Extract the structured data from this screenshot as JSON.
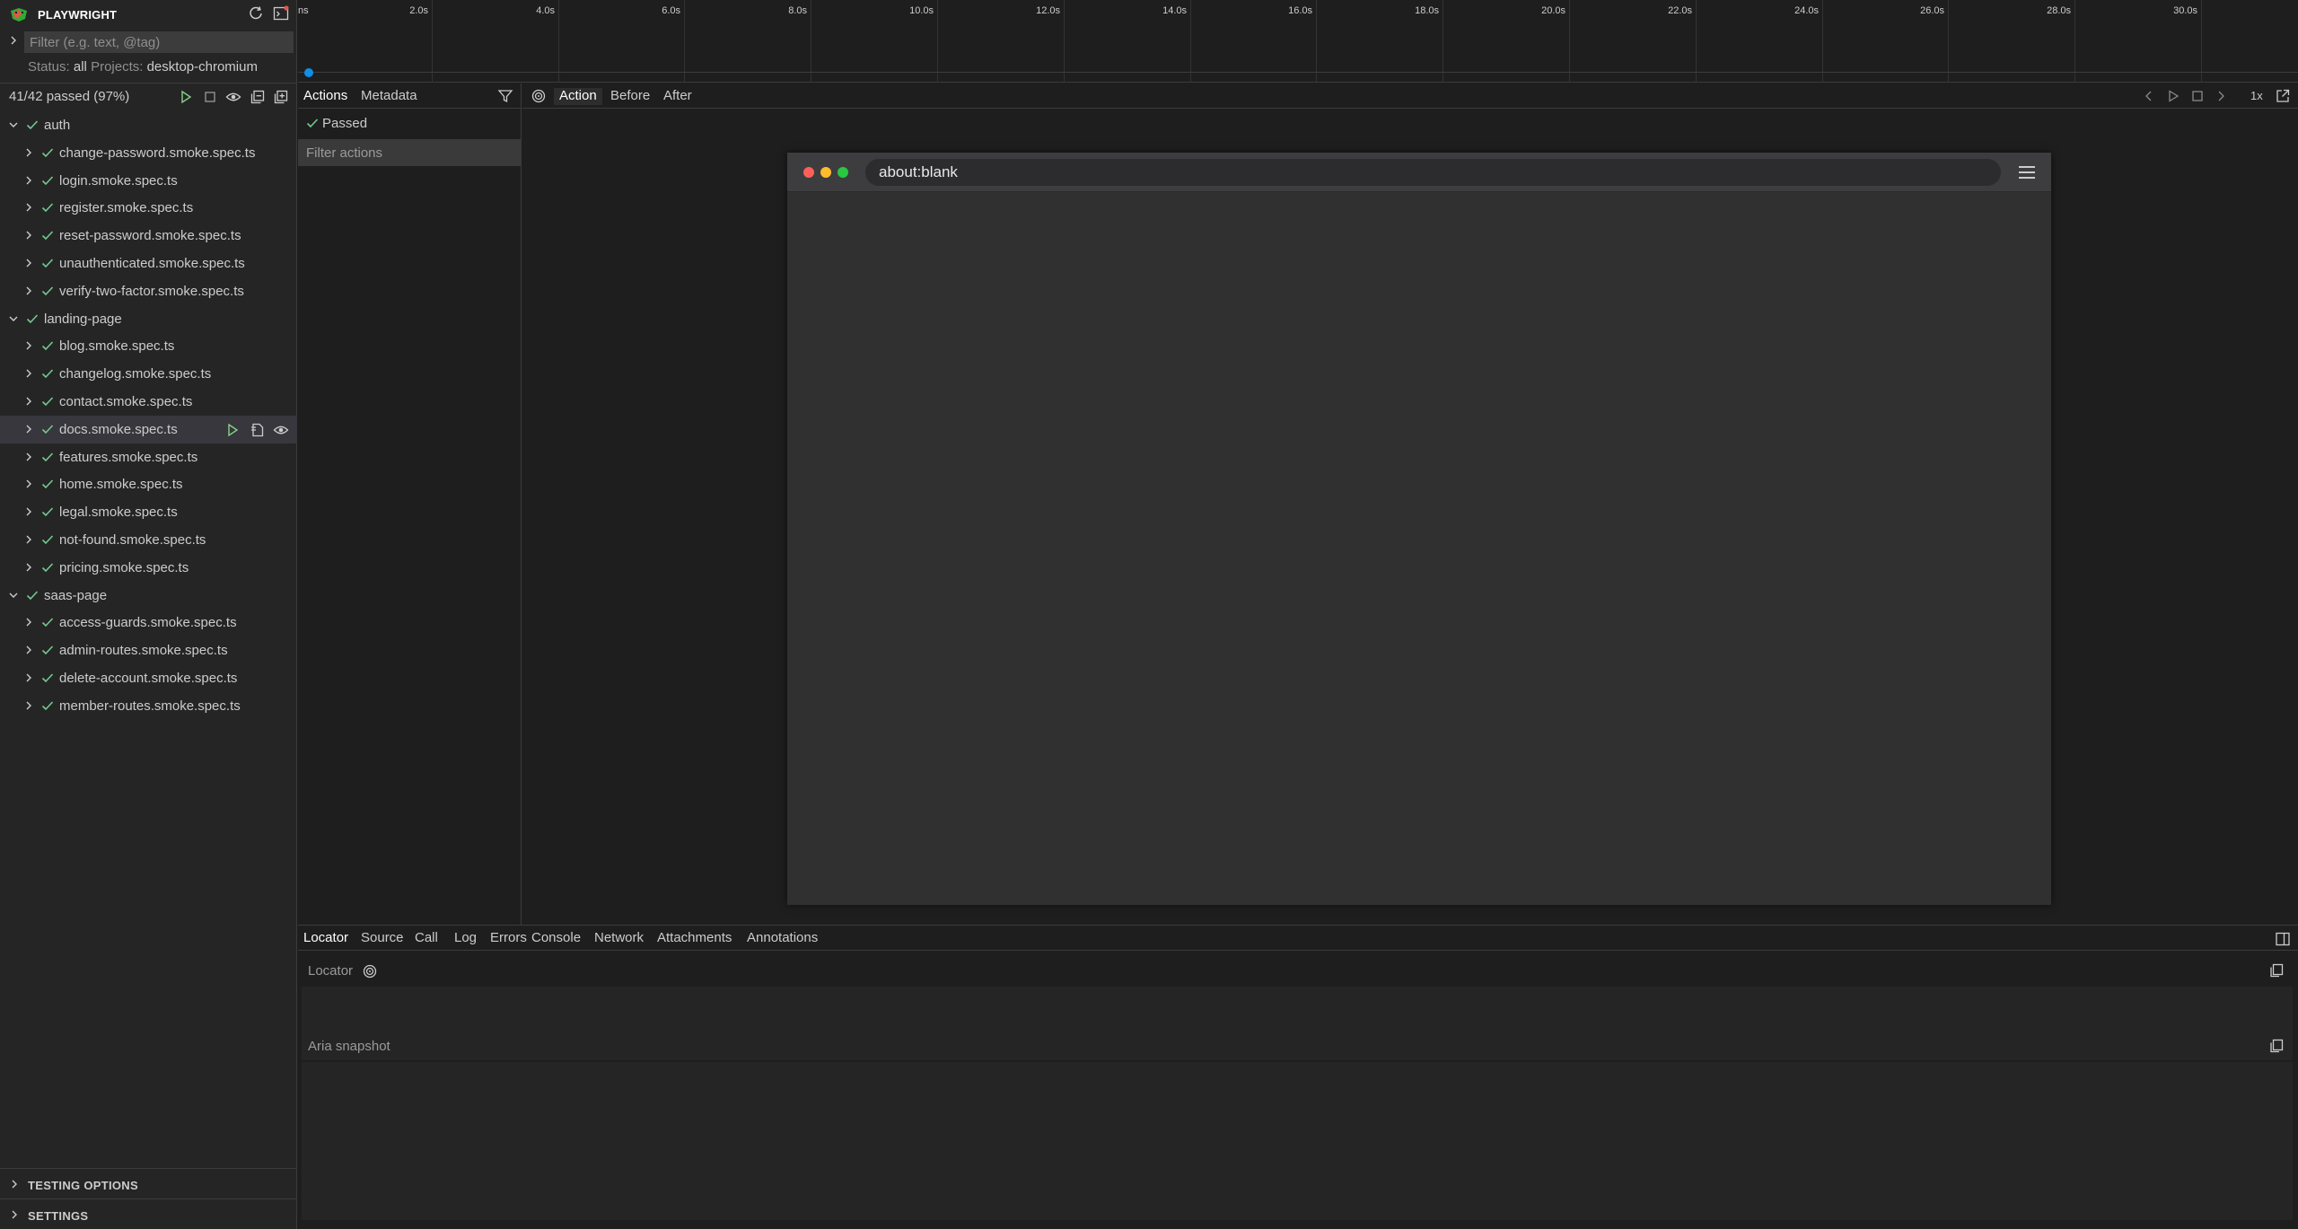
{
  "app": {
    "title": "PLAYWRIGHT",
    "filter_placeholder": "Filter (e.g. text, @tag)",
    "status_label": "Status:",
    "status_value": "all",
    "projects_label": "Projects:",
    "projects_value": "desktop-chromium",
    "summary": "41/42 passed (97%)"
  },
  "tree": [
    {
      "label": "auth",
      "level": 0,
      "expanded": true
    },
    {
      "label": "change-password.smoke.spec.ts",
      "level": 1
    },
    {
      "label": "login.smoke.spec.ts",
      "level": 1
    },
    {
      "label": "register.smoke.spec.ts",
      "level": 1
    },
    {
      "label": "reset-password.smoke.spec.ts",
      "level": 1
    },
    {
      "label": "unauthenticated.smoke.spec.ts",
      "level": 1
    },
    {
      "label": "verify-two-factor.smoke.spec.ts",
      "level": 1
    },
    {
      "label": "landing-page",
      "level": 0,
      "expanded": true
    },
    {
      "label": "blog.smoke.spec.ts",
      "level": 1
    },
    {
      "label": "changelog.smoke.spec.ts",
      "level": 1
    },
    {
      "label": "contact.smoke.spec.ts",
      "level": 1
    },
    {
      "label": "docs.smoke.spec.ts",
      "level": 1,
      "selected": true
    },
    {
      "label": "features.smoke.spec.ts",
      "level": 1
    },
    {
      "label": "home.smoke.spec.ts",
      "level": 1
    },
    {
      "label": "legal.smoke.spec.ts",
      "level": 1
    },
    {
      "label": "not-found.smoke.spec.ts",
      "level": 1
    },
    {
      "label": "pricing.smoke.spec.ts",
      "level": 1
    },
    {
      "label": "saas-page",
      "level": 0,
      "expanded": true
    },
    {
      "label": "access-guards.smoke.spec.ts",
      "level": 1
    },
    {
      "label": "admin-routes.smoke.spec.ts",
      "level": 1
    },
    {
      "label": "delete-account.smoke.spec.ts",
      "level": 1
    },
    {
      "label": "member-routes.smoke.spec.ts",
      "level": 1
    }
  ],
  "sidebar_bottom": {
    "testing_options": "TESTING OPTIONS",
    "settings": "SETTINGS"
  },
  "timeline": {
    "ticks": [
      "2.0s",
      "4.0s",
      "6.0s",
      "8.0s",
      "10.0s",
      "12.0s",
      "14.0s",
      "16.0s",
      "18.0s",
      "20.0s",
      "22.0s",
      "24.0s",
      "26.0s",
      "28.0s",
      "30.0s"
    ],
    "first_partial_label": "ns"
  },
  "actions_panel": {
    "tabs": [
      "Actions",
      "Metadata"
    ],
    "passed": "Passed",
    "filter_placeholder": "Filter actions"
  },
  "snapshot": {
    "tabs": [
      "Action",
      "Before",
      "After"
    ],
    "speed": "1x",
    "url": "about:blank"
  },
  "bottom_panel": {
    "tabs": [
      "Locator",
      "Source",
      "Call",
      "Log",
      "Errors",
      "Console",
      "Network",
      "Attachments",
      "Annotations"
    ],
    "locator_title": "Locator",
    "aria_title": "Aria snapshot"
  },
  "colors": {
    "check_green": "#73c991",
    "run_green": "#89d185",
    "accent_blue": "#0e8fe8",
    "logo_red": "#e2574c",
    "logo_green": "#2ead33"
  }
}
